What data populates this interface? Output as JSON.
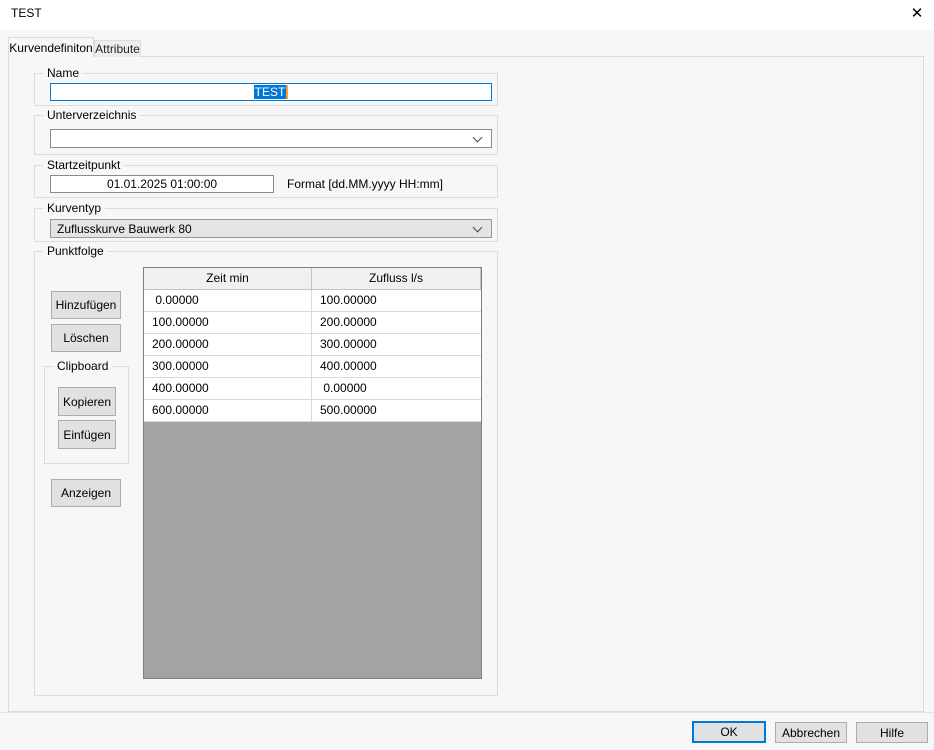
{
  "window": {
    "title": "TEST"
  },
  "icons": {
    "close": "✕",
    "combo_arrow": "chevron-down"
  },
  "colors": {
    "accent": "#0078d7",
    "selection": "#0078d7",
    "caret": "#ffa12e",
    "table_empty": "#a3a3a3"
  },
  "tabs": [
    {
      "label": "Kurvendefiniton",
      "active": true
    },
    {
      "label": "Attribute",
      "active": false
    }
  ],
  "form": {
    "name": {
      "label": "Name",
      "value": "TEST",
      "selected": true
    },
    "unterverzeichnis": {
      "label": "Unterverzeichnis",
      "value": ""
    },
    "startzeitpunkt": {
      "label": "Startzeitpunkt",
      "value": "01.01.2025 01:00:00",
      "format_hint": "Format [dd.MM.yyyy HH:mm]"
    },
    "kurventyp": {
      "label": "Kurventyp",
      "value": "Zuflusskurve Bauwerk 80"
    },
    "punktfolge": {
      "label": "Punktfolge",
      "buttons": {
        "add": "Hinzufügen",
        "delete": "Löschen",
        "show": "Anzeigen"
      },
      "clipboard": {
        "label": "Clipboard",
        "copy": "Kopieren",
        "paste": "Einfügen"
      },
      "table": {
        "columns": [
          "Zeit min",
          "Zufluss l/s"
        ],
        "rows": [
          [
            " 0.00000",
            "100.00000"
          ],
          [
            "100.00000",
            "200.00000"
          ],
          [
            "200.00000",
            "300.00000"
          ],
          [
            "300.00000",
            "400.00000"
          ],
          [
            "400.00000",
            " 0.00000"
          ],
          [
            "600.00000",
            "500.00000"
          ]
        ]
      }
    }
  },
  "footer": {
    "ok": "OK",
    "cancel": "Abbrechen",
    "help": "Hilfe"
  }
}
